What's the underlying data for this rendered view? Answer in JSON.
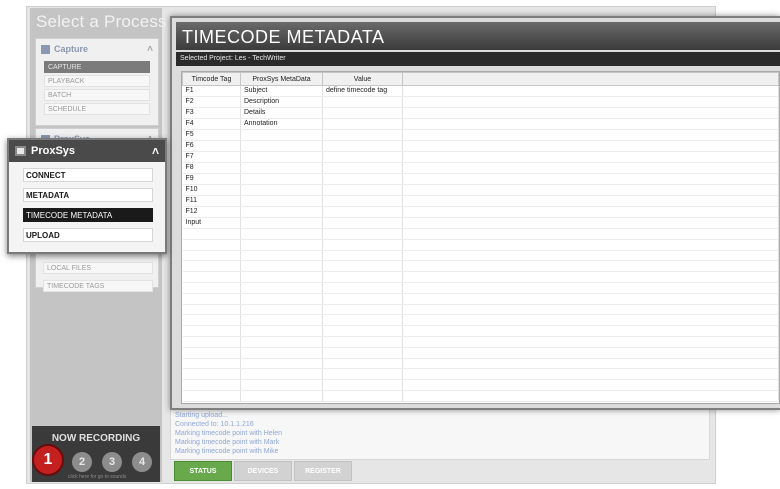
{
  "sidebar": {
    "title": "Select a Process",
    "capture": {
      "label": "Capture",
      "items": [
        "CAPTURE",
        "PLAYBACK",
        "BATCH",
        "SCHEDULE"
      ]
    },
    "proxsys_collapsed_label": "ProxSys",
    "extra_items": [
      "LOCAL FILES",
      "TIMECODE TAGS"
    ]
  },
  "popup": {
    "title": "ProxSys",
    "items": [
      "CONNECT",
      "METADATA",
      "TIMECODE METADATA",
      "UPLOAD"
    ],
    "selected": "TIMECODE METADATA"
  },
  "recording": {
    "title": "NOW RECORDING",
    "buttons": [
      "1",
      "2",
      "3",
      "4"
    ],
    "hint": "click here for go to sounds"
  },
  "main": {
    "title": "TIMECODE METADATA",
    "project": "Selected Project: Les - TechWriter",
    "columns": [
      "Timcode Tag",
      "ProxSys MetaData",
      "Value",
      ""
    ],
    "rows": [
      [
        "F1",
        "Subject",
        "define timecode tag"
      ],
      [
        "F2",
        "Description",
        ""
      ],
      [
        "F3",
        "Details",
        ""
      ],
      [
        "F4",
        "Annotation",
        ""
      ],
      [
        "F5",
        "",
        ""
      ],
      [
        "F6",
        "",
        ""
      ],
      [
        "F7",
        "",
        ""
      ],
      [
        "F8",
        "",
        ""
      ],
      [
        "F9",
        "",
        ""
      ],
      [
        "F10",
        "",
        ""
      ],
      [
        "F11",
        "",
        ""
      ],
      [
        "F12",
        "",
        ""
      ],
      [
        "Input",
        "",
        ""
      ]
    ]
  },
  "log": {
    "lines": [
      "Starting upload...",
      "Connected to: 10.1.1.216",
      "Marking timecode point with Helen",
      "Marking timecode point with Mark",
      "Marking timecode point with Mike"
    ]
  },
  "tabs": [
    "STATUS",
    "DEVICES",
    "REGISTER"
  ]
}
